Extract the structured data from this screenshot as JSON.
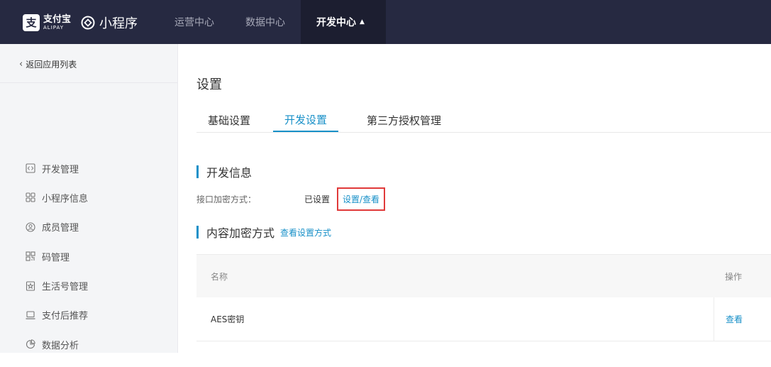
{
  "header": {
    "alipay_logo_glyph": "支",
    "alipay_cn": "支付宝",
    "alipay_en": "ALIPAY",
    "mini_program": "小程序",
    "nav": [
      {
        "label": "运营中心",
        "active": false
      },
      {
        "label": "数据中心",
        "active": false
      },
      {
        "label": "开发中心",
        "active": true
      }
    ]
  },
  "sidebar": {
    "back_label": "返回应用列表",
    "items": [
      {
        "label": "开发管理",
        "icon": "code-icon"
      },
      {
        "label": "小程序信息",
        "icon": "grid-icon"
      },
      {
        "label": "成员管理",
        "icon": "user-circle-icon"
      },
      {
        "label": "码管理",
        "icon": "qr-code-icon"
      },
      {
        "label": "生活号管理",
        "icon": "badge-icon"
      },
      {
        "label": "支付后推荐",
        "icon": "laptop-icon"
      },
      {
        "label": "数据分析",
        "icon": "pie-chart-icon"
      }
    ]
  },
  "main": {
    "title": "设置",
    "tabs": [
      {
        "label": "基础设置",
        "active": false
      },
      {
        "label": "开发设置",
        "active": true
      },
      {
        "label": "第三方授权管理",
        "active": false
      }
    ],
    "dev_info": {
      "title": "开发信息",
      "api_encrypt_label": "接口加密方式：",
      "api_encrypt_value": "已设置",
      "api_encrypt_action": "设置/查看"
    },
    "content_encrypt": {
      "title": "内容加密方式",
      "link": "查看设置方式",
      "columns": {
        "name": "名称",
        "op": "操作"
      },
      "rows": [
        {
          "name": "AES密钥",
          "op": "查看"
        }
      ]
    }
  },
  "colors": {
    "topbar": "#262941",
    "accent": "#1890c8",
    "highlight_box": "#e03a3a"
  }
}
